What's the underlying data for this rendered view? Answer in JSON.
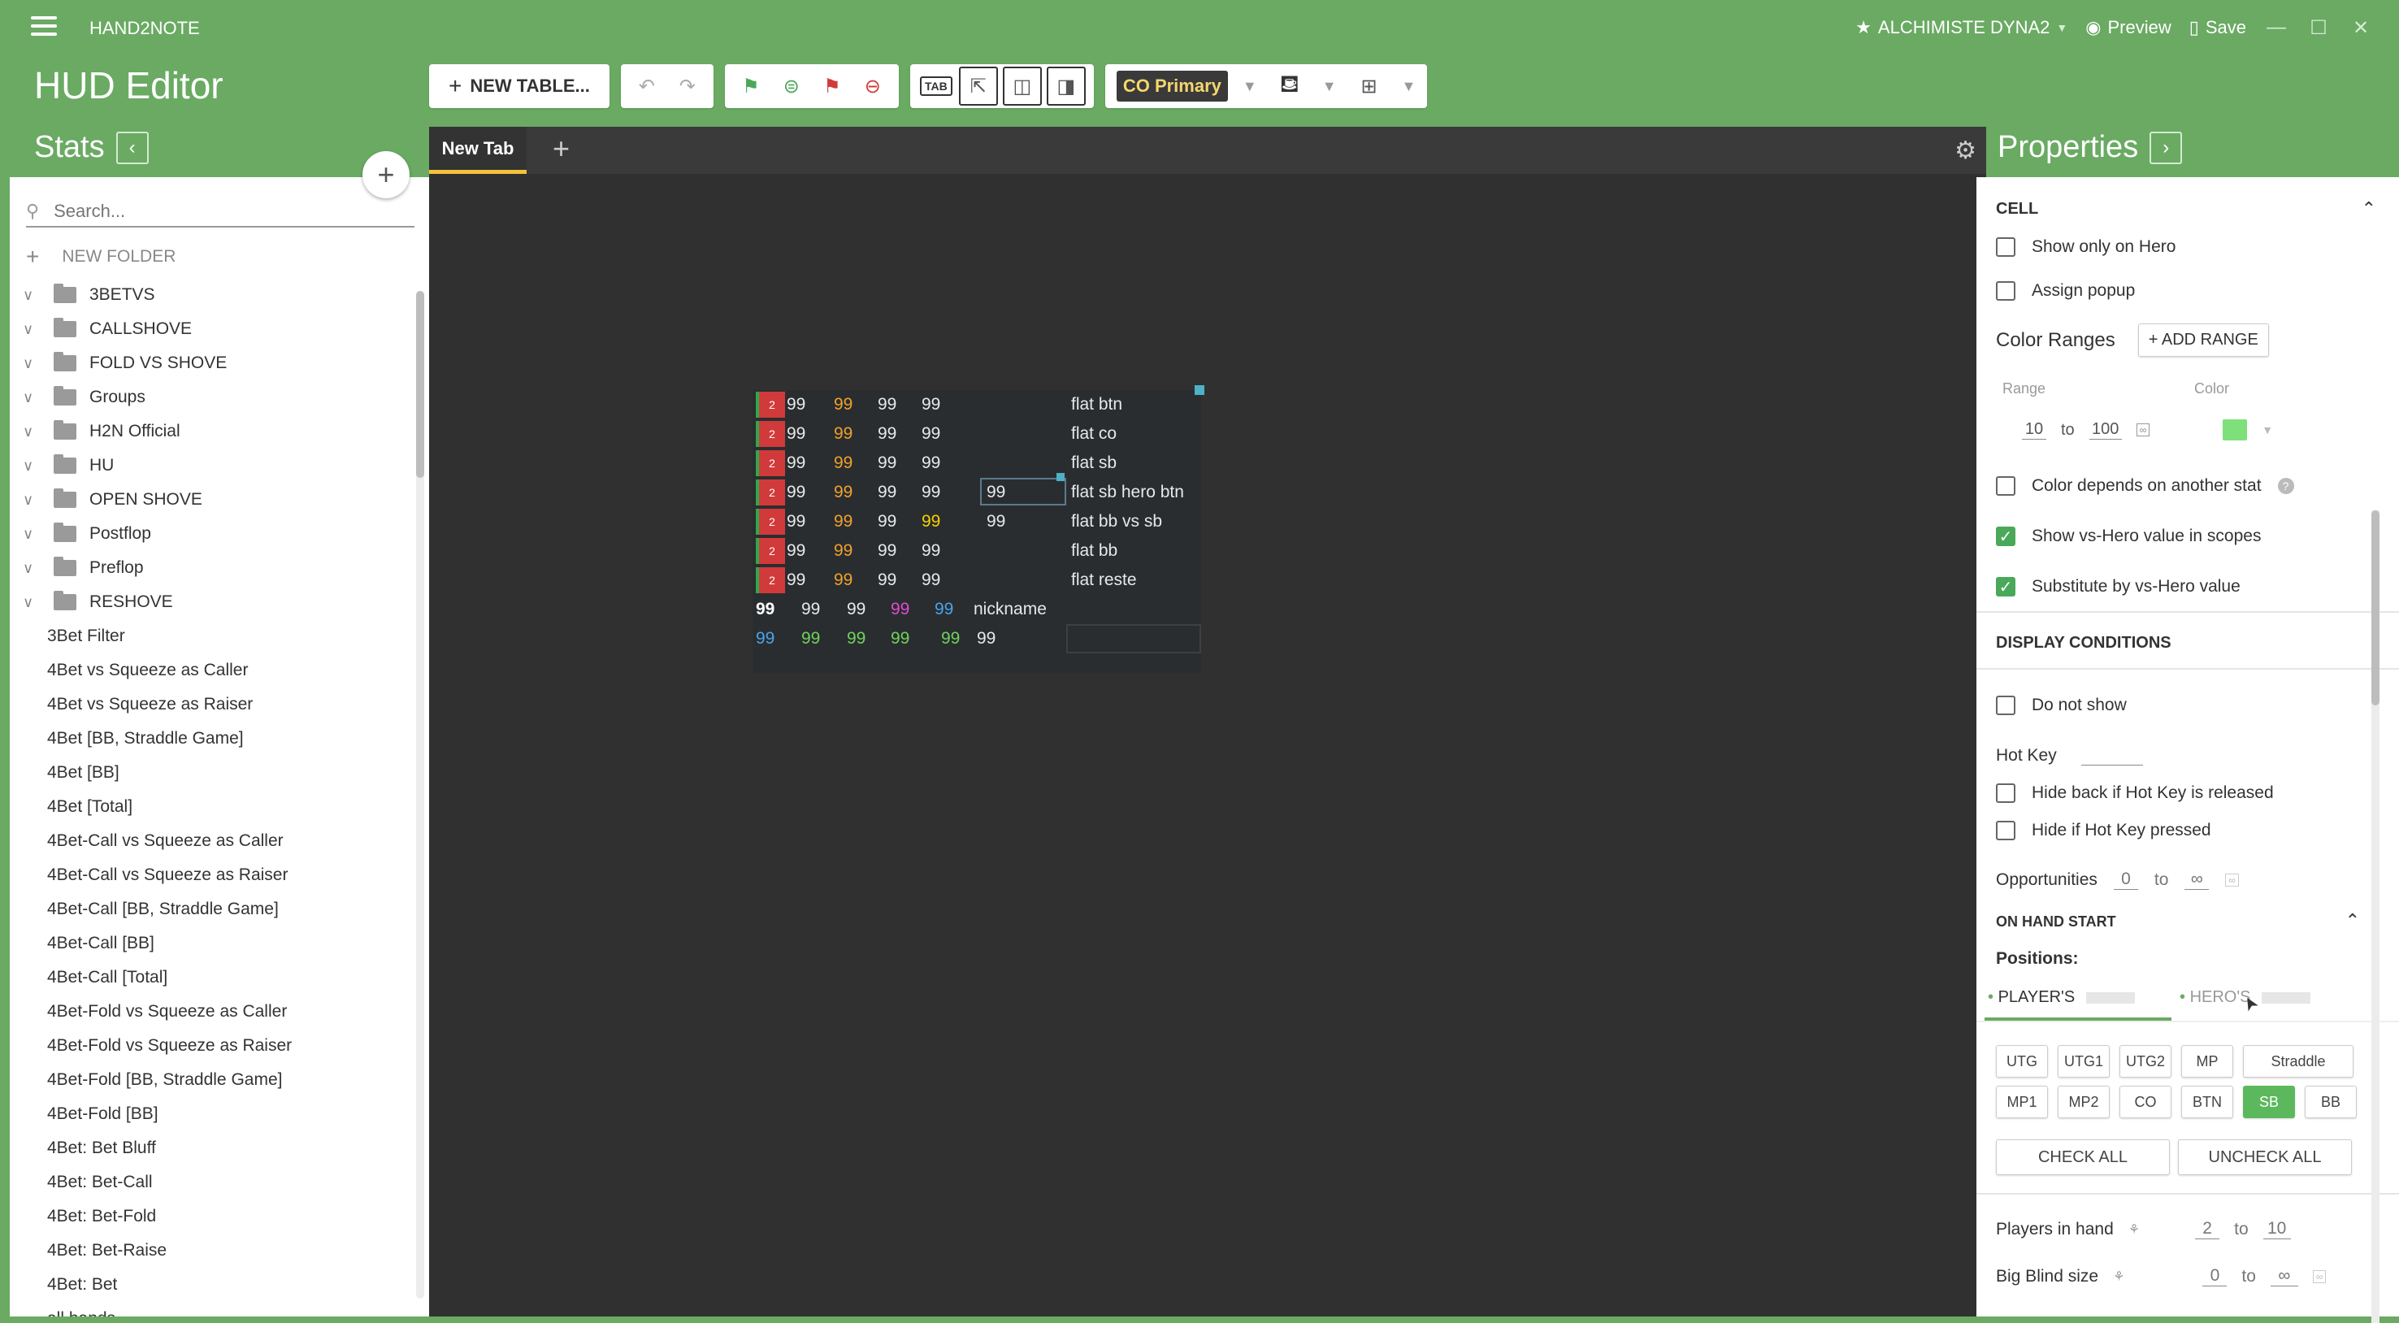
{
  "app": {
    "title": "HAND2NOTE"
  },
  "titlebar": {
    "profile": "ALCHIMISTE DYNA2",
    "preview": "Preview",
    "save": "Save"
  },
  "page_title": "HUD Editor",
  "toolbar": {
    "new_table": "NEW TABLE...",
    "tab_label": "TAB",
    "profile_select": "CO Primary"
  },
  "stats": {
    "title": "Stats",
    "search_placeholder": "Search...",
    "new_folder": "NEW FOLDER",
    "folders": [
      "3BETVS",
      "CALLSHOVE",
      "FOLD VS SHOVE",
      "Groups",
      "H2N Official",
      "HU",
      "OPEN SHOVE",
      "Postflop",
      "Preflop",
      "RESHOVE"
    ],
    "items": [
      "3Bet Filter",
      "4Bet vs Squeeze as Caller",
      "4Bet vs Squeeze as Raiser",
      "4Bet [BB, Straddle Game]",
      "4Bet [BB]",
      "4Bet [Total]",
      "4Bet-Call vs Squeeze as Caller",
      "4Bet-Call vs Squeeze as Raiser",
      "4Bet-Call [BB, Straddle Game]",
      "4Bet-Call [BB]",
      "4Bet-Call [Total]",
      "4Bet-Fold vs Squeeze as Caller",
      "4Bet-Fold vs Squeeze as Raiser",
      "4Bet-Fold [BB, Straddle Game]",
      "4Bet-Fold [BB]",
      "4Bet: Bet Bluff",
      "4Bet: Bet-Call",
      "4Bet: Bet-Fold",
      "4Bet: Bet-Raise",
      "4Bet: Bet",
      "all hands"
    ]
  },
  "editor": {
    "tab": "New Tab",
    "hud": {
      "badge": "2",
      "val": "99",
      "labels": [
        "flat btn",
        "flat co",
        "flat sb",
        "flat sb hero btn",
        "flat bb vs sb",
        "flat bb",
        "flat reste"
      ],
      "nickname": "nickname"
    }
  },
  "properties": {
    "title": "Properties",
    "cell_section": "CELL",
    "show_only_hero": "Show only on Hero",
    "assign_popup": "Assign popup",
    "color_ranges": "Color Ranges",
    "add_range": "+ ADD RANGE",
    "range_header": "Range",
    "color_header": "Color",
    "range_from": "10",
    "range_to_word": "to",
    "range_to": "100",
    "color_depends": "Color depends on another stat",
    "show_vs_hero": "Show vs-Hero value in scopes",
    "substitute": "Substitute by vs-Hero value",
    "display_conditions": "DISPLAY CONDITIONS",
    "do_not_show": "Do not show",
    "hot_key": "Hot Key",
    "hide_back": "Hide back if Hot Key is released",
    "hide_if": "Hide if Hot Key pressed",
    "opportunities": "Opportunities",
    "opp_from": "0",
    "opp_to": "∞",
    "on_hand_start": "ON HAND START",
    "positions": "Positions:",
    "players_tab": "PLAYER'S",
    "heros_tab": "HERO'S",
    "pos_row1": [
      "UTG",
      "UTG1",
      "UTG2",
      "MP",
      "Straddle"
    ],
    "pos_row2": [
      "MP1",
      "MP2",
      "CO",
      "BTN",
      "SB",
      "BB"
    ],
    "check_all": "CHECK ALL",
    "uncheck_all": "UNCHECK ALL",
    "players_in_hand": "Players in hand",
    "pih_from": "2",
    "pih_to": "10",
    "big_blind": "Big Blind size",
    "bb_from": "0",
    "bb_to": "∞"
  },
  "colors": {
    "accent": "#6aaa63",
    "canvas": "#303030",
    "badge_red": "#d13a3a",
    "checkbox_on": "#4aa85a",
    "range_color": "#7ee07a",
    "tab_underline": "#f3c23b"
  }
}
